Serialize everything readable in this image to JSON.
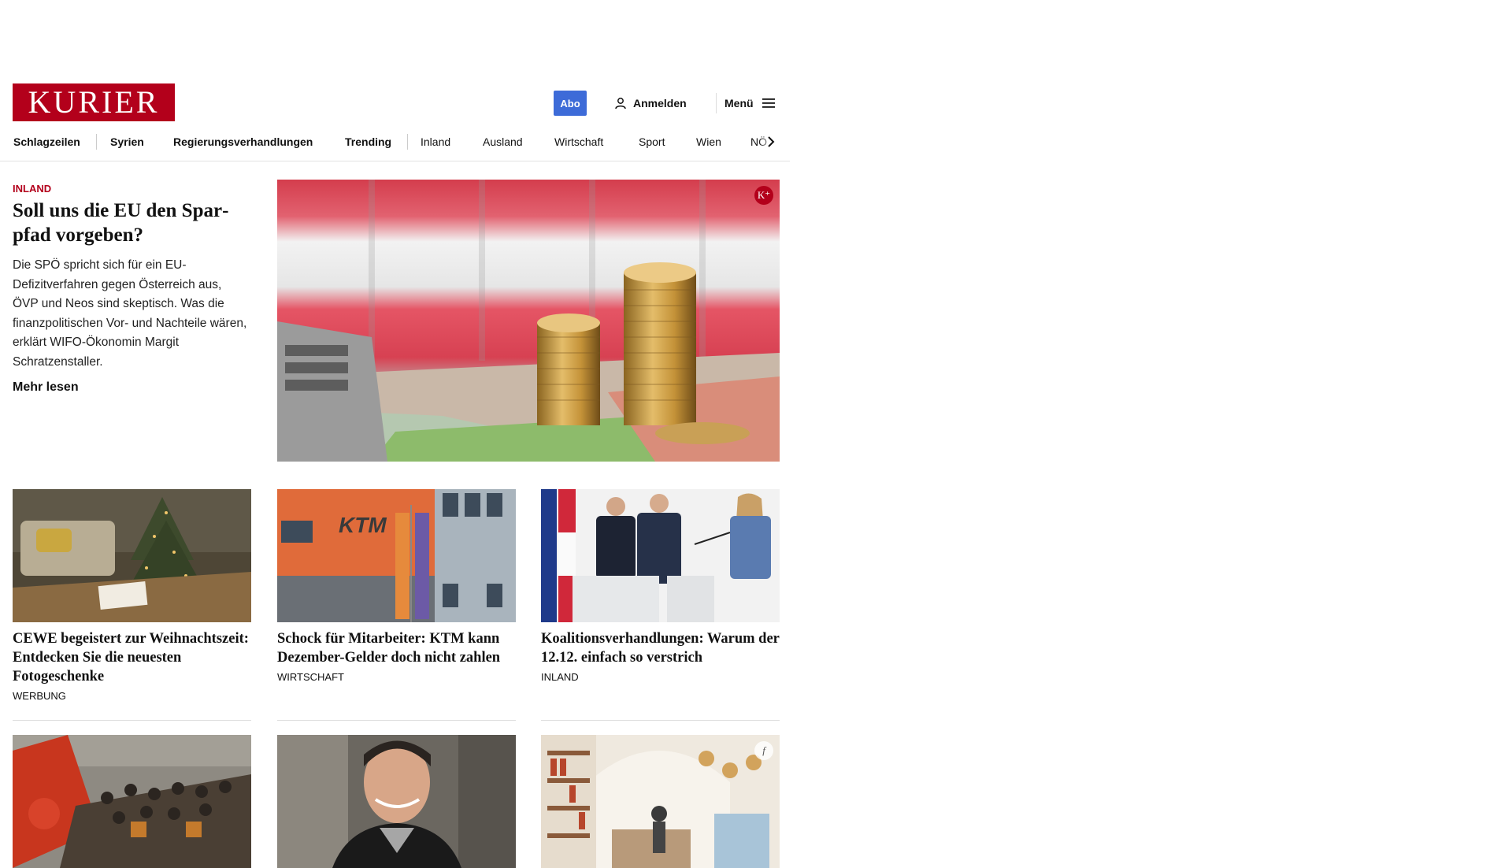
{
  "header": {
    "logo_text": "KURIER",
    "abo_label": "Abo",
    "login_label": "Anmelden",
    "menu_label": "Menü"
  },
  "nav": {
    "items": [
      "Schlagzeilen",
      "Syrien",
      "Regierungsverhandlungen",
      "Trending",
      "Inland",
      "Ausland",
      "Wirtschaft",
      "Sport",
      "Wien",
      "NÖ"
    ]
  },
  "lead": {
    "category": "INLAND",
    "title": "Soll uns die EU den Spar­pfad vorgeben?",
    "text": "Die SPÖ spricht sich für ein EU-Defizitverfahren gegen Österreich aus, ÖVP und Neos sind skeptisch. Was die finanzpolitischen Vor- und Nachteile wären, erklärt WIFO-Ökonomin Margit Schratzenstaller.",
    "more": "Mehr lesen",
    "badge": "K⁺"
  },
  "cards": [
    {
      "title": "CEWE begeistert zur Weihnachts­zeit: Entdecken Sie die neuesten Fotogeschenke",
      "category": "WERBUNG"
    },
    {
      "title": "Schock für Mitarbeiter: KTM kann Dezember-Gelder doch nicht zahlen",
      "category": "WIRTSCHAFT"
    },
    {
      "title": "Koalitionsverhandlungen: Warum der 12.12. einfach so verstrich",
      "category": "INLAND"
    }
  ],
  "colors": {
    "brand": "#b3001b",
    "abo": "#3d6bd8"
  }
}
